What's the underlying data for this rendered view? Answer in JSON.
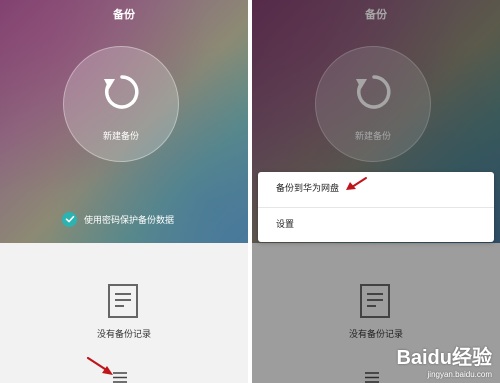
{
  "left": {
    "title": "备份",
    "new_backup_label": "新建备份",
    "password_protect_label": "使用密码保护备份数据",
    "empty_label": "没有备份记录"
  },
  "right": {
    "title": "备份",
    "new_backup_label": "新建备份",
    "empty_label": "没有备份记录",
    "menu_items": [
      "备份到华为网盘",
      "设置"
    ]
  },
  "watermark": {
    "logo": "Baidu经验",
    "url": "jingyan.baidu.com"
  },
  "colors": {
    "accent": "#2ab3b0",
    "arrow": "#c0141b",
    "bottom_bg": "#f2f2f2"
  },
  "icons": [
    "refresh-icon",
    "check-icon",
    "document-icon",
    "menu-icon",
    "arrow-annotation"
  ]
}
